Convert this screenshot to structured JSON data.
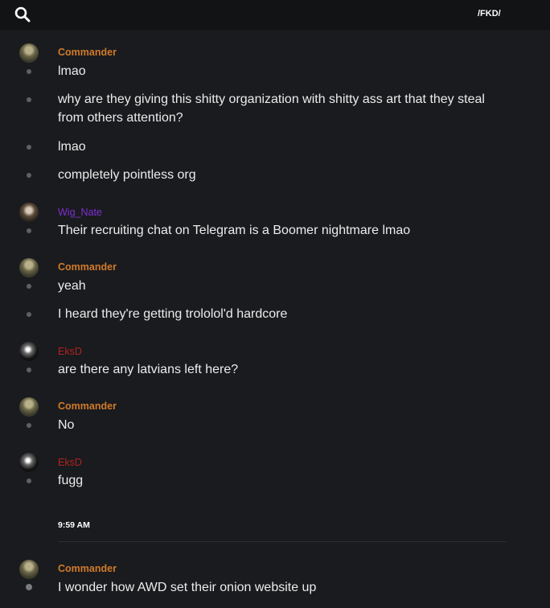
{
  "header": {
    "search_icon": "search-icon",
    "channel": "/FKD/"
  },
  "colors": {
    "commander": "#d07a2a",
    "wig_nate": "#7d2fd4",
    "eksd": "#b22222"
  },
  "messages": [
    {
      "author": "Commander",
      "text": "lmao"
    },
    {
      "text": "why are they giving this shitty organization with shitty ass art that they steal from others attention?"
    },
    {
      "text": "lmao"
    },
    {
      "text": "completely pointless org"
    },
    {
      "author": "Wig_Nate",
      "text": "Their recruiting chat on Telegram is a Boomer nightmare lmao"
    },
    {
      "author": "Commander",
      "text": "yeah"
    },
    {
      "text": "I heard they're getting trololol'd hardcore"
    },
    {
      "author": "EksD",
      "text": "are there any latvians left here?"
    },
    {
      "author": "Commander",
      "text": "No"
    },
    {
      "author": "EksD",
      "text": "fugg"
    },
    {
      "author": "Commander",
      "text": "I wonder how AWD set their onion website up"
    }
  ],
  "timestamp": "9:59 AM"
}
